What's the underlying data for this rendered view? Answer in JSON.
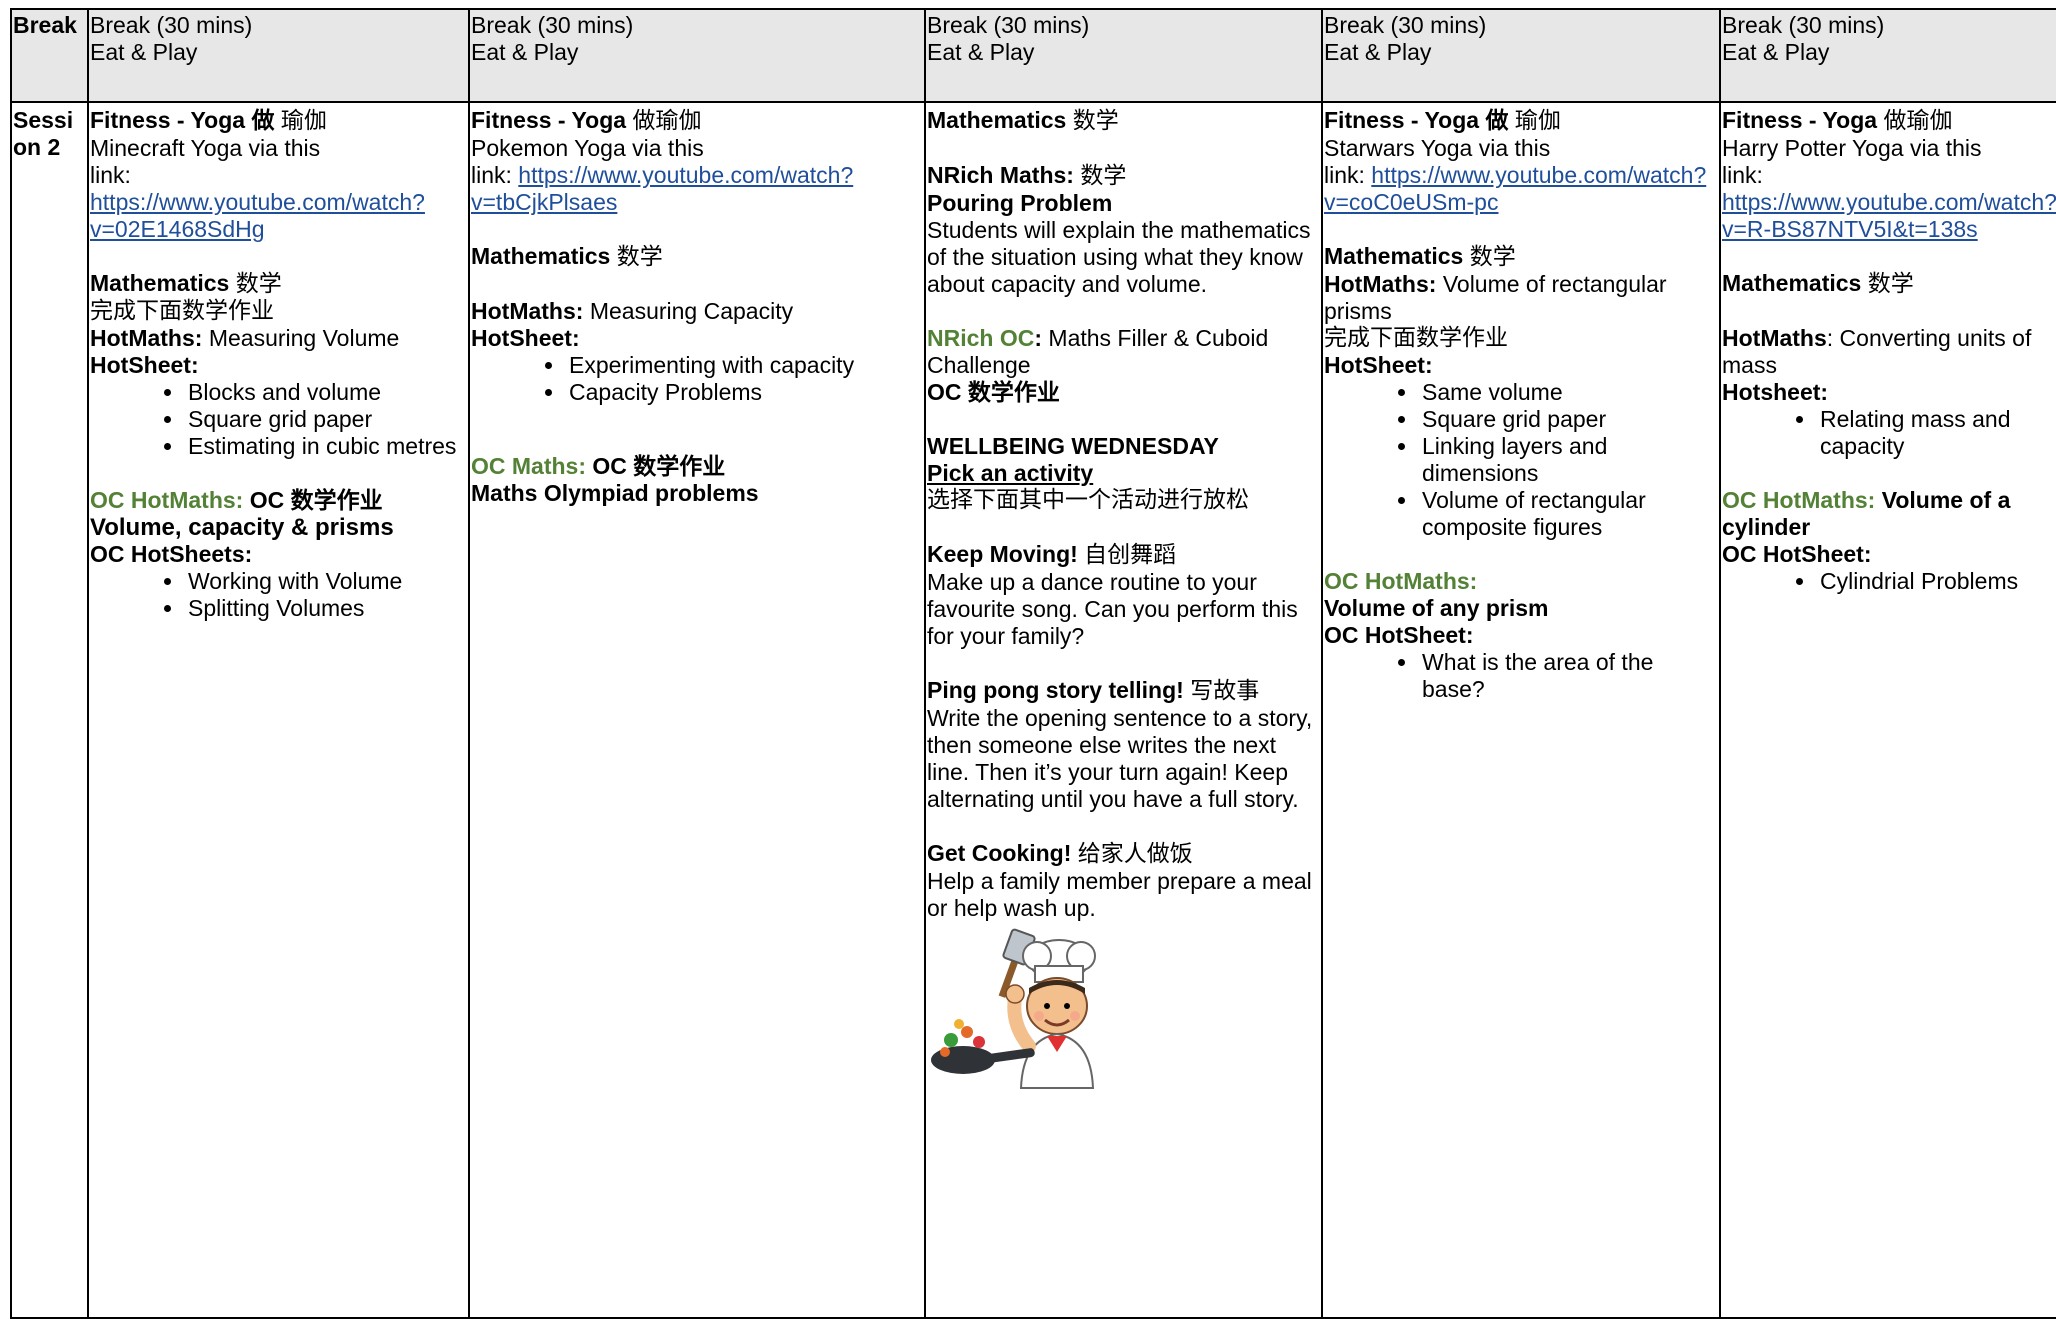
{
  "break_row": {
    "label": "Break",
    "days": [
      {
        "line1": "Break (30 mins)",
        "line2": "Eat & Play"
      },
      {
        "line1": "Break (30 mins)",
        "line2": "Eat & Play"
      },
      {
        "line1": "Break (30 mins)",
        "line2": "Eat & Play"
      },
      {
        "line1": "Break (30 mins)",
        "line2": "Eat & Play"
      },
      {
        "line1": "Break (30 mins)",
        "line2": "Eat & Play"
      }
    ]
  },
  "session2": {
    "label": "Session 2",
    "mon": {
      "fit_title": "Fitness - Yoga",
      "fit_cn_b": "做",
      "fit_cn": "瑜伽",
      "yoga_text": "Minecraft Yoga via this",
      "link_prefix": "link: ",
      "link": "https://www.youtube.com/watch?v=02E1468SdHg",
      "math_title": "Mathematics",
      "math_cn": "数学",
      "math_cn2": "完成下面数学作业",
      "hm_label": "HotMaths:",
      "hm_text": " Measuring Volume",
      "hs_label": "HotSheet:",
      "hs_items": [
        "Blocks and volume",
        "Square grid paper",
        "Estimating in cubic metres"
      ],
      "oc_label": "OC HotMaths:",
      "oc_cn": " OC 数学作业",
      "oc_title": "Volume, capacity & prisms",
      "ocs_label": "OC HotSheets:",
      "ocs_items": [
        "Working with Volume",
        "Splitting Volumes"
      ]
    },
    "tue": {
      "fit_title": "Fitness - Yoga",
      "fit_cn": "做瑜伽",
      "yoga_text": "Pokemon Yoga via this",
      "link_prefix": "link: ",
      "link": "https://www.youtube.com/watch?v=tbCjkPlsaes",
      "math_title": "Mathematics",
      "math_cn": "数学",
      "hm_label": "HotMaths:",
      "hm_text": " Measuring Capacity",
      "hs_label": "HotSheet:",
      "hs_items": [
        "Experimenting with capacity",
        "Capacity Problems"
      ],
      "oc_label": "OC Maths:",
      "oc_cn": " OC 数学作业",
      "olymp": "Maths Olympiad problems"
    },
    "wed": {
      "math_title": "Mathematics",
      "math_cn": "数学",
      "nrich_label": "NRich Maths:",
      "nrich_cn": "数学",
      "pour_title": "Pouring Problem",
      "pour_text": "Students will explain the mathematics of the situation using what they know about capacity and volume.",
      "nrich_oc_label": "NRich OC",
      "nrich_oc_colon": ":",
      "nrich_oc_text": " Maths Filler & Cuboid Challenge",
      "oc_cn": "OC 数学作业",
      "wellbeing": "WELLBEING WEDNESDAY",
      "pick": "Pick an activity",
      "pick_cn": "选择下面其中一个活动进行放松",
      "keep_title": "Keep Moving!",
      "keep_cn": "自创舞蹈",
      "keep_text": "Make up a dance routine to your favourite song. Can you perform this for your family?",
      "ping_title": "Ping pong story telling!",
      "ping_cn": "写故事",
      "ping_text": "Write the opening sentence to a story, then someone else writes the next line. Then it’s your turn again! Keep alternating until you have a full story.",
      "cook_title": "Get Cooking!",
      "cook_cn": "给家人做饭",
      "cook_text": "Help a family member prepare a meal or help wash up."
    },
    "thu": {
      "fit_title": "Fitness - Yoga",
      "fit_cn_b": "做",
      "fit_cn": "瑜伽",
      "yoga_text": "Starwars Yoga via this",
      "link_prefix": "link: ",
      "link": "https://www.youtube.com/watch?v=coC0eUSm-pc",
      "math_title": "Mathematics",
      "math_cn": "数学",
      "hm_label": "HotMaths:",
      "hm_text": " Volume of rectangular prisms",
      "math_cn2": "完成下面数学作业",
      "hs_label": "HotSheet:",
      "hs_items": [
        "Same volume",
        "Square grid paper",
        "Linking layers and dimensions",
        "Volume of rectangular composite figures"
      ],
      "oc_label": "OC HotMaths:",
      "oc_title": "Volume of any prism",
      "ocs_label": "OC HotSheet:",
      "ocs_items": [
        "What is the area of the base?"
      ]
    },
    "fri": {
      "fit_title": "Fitness - Yoga",
      "fit_cn": "做瑜伽",
      "yoga_text": "Harry Potter Yoga via this",
      "link_prefix": "link: ",
      "link": "https://www.youtube.com/watch?v=R-BS87NTV5I&t=138s",
      "math_title": "Mathematics",
      "math_cn": "数学",
      "hm_label": "HotMaths",
      "hm_text": ": Converting units of mass",
      "hs_label": "Hotsheet:",
      "hs_items": [
        "Relating mass and capacity"
      ],
      "oc_label": "OC HotMaths:",
      "oc_title": " Volume of a cylinder",
      "ocs_label": "OC HotSheet:",
      "ocs_items": [
        "Cylindrial Problems"
      ]
    }
  }
}
